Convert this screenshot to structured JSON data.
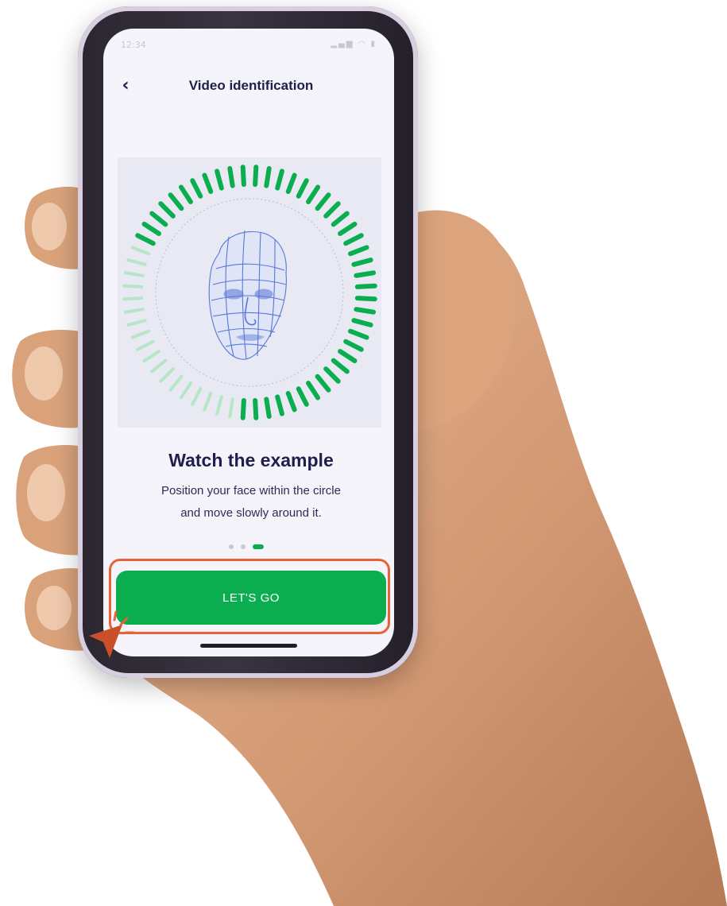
{
  "status_bar": {
    "time": "12:34",
    "icons": "▂▄▆ ◠ ▮"
  },
  "nav": {
    "back_icon": "chevron-left-icon",
    "back_glyph": "‹",
    "title": "Video identification"
  },
  "illustration": {
    "icon": "face-scan-icon",
    "ring_color_active": "#0aae4f",
    "ring_color_inactive": "#b5e6c6",
    "face_color": "#5877d6",
    "progress": 0.7
  },
  "content": {
    "heading": "Watch the example",
    "subtext_line1": "Position your face within the circle",
    "subtext_line2": "and move slowly around it."
  },
  "pager": {
    "count": 3,
    "active_index": 2
  },
  "cta": {
    "label": "LET'S GO"
  },
  "colors": {
    "accent": "#0aae4f",
    "highlight": "#e8613a",
    "text_dark": "#1e1f4b",
    "screen_bg": "#f4f4fa"
  }
}
